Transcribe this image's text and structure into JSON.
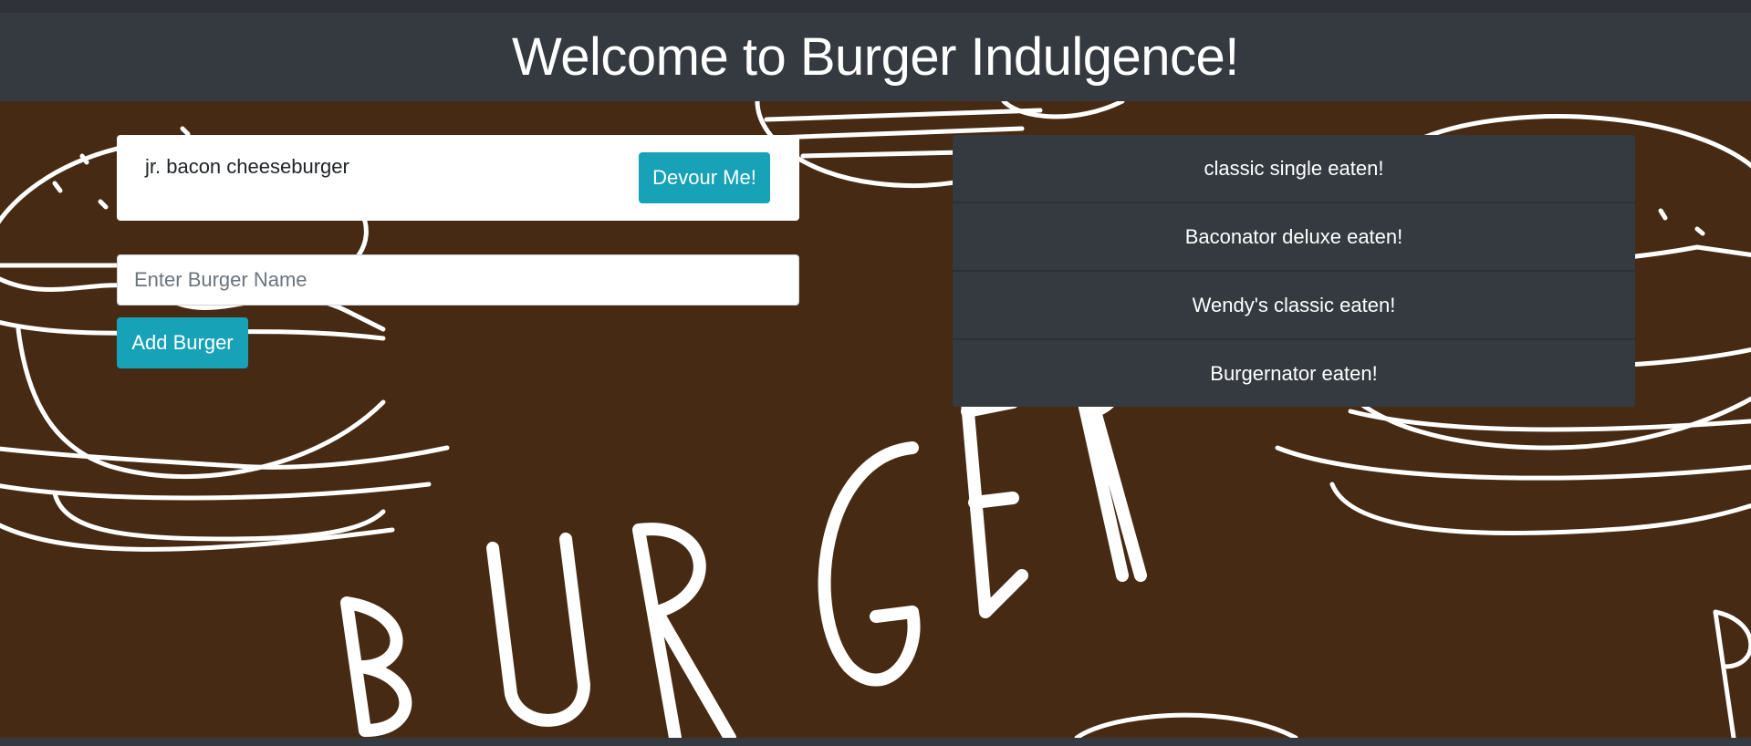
{
  "header": {
    "title": "Welcome to Burger Indulgence!"
  },
  "background": {
    "color": "#462a13",
    "stroke": "#ffffff",
    "wordmark": "BURGER"
  },
  "uneaten": [
    {
      "name": "jr. bacon cheeseburger",
      "button_label": "Devour Me!"
    }
  ],
  "form": {
    "placeholder": "Enter Burger Name",
    "value": "",
    "submit_label": "Add Burger"
  },
  "eaten": [
    {
      "label": "classic single eaten!"
    },
    {
      "label": "Baconator deluxe eaten!"
    },
    {
      "label": "Wendy's classic eaten!"
    },
    {
      "label": "Burgernator eaten!"
    }
  ],
  "colors": {
    "accent": "#17a2b8",
    "dark": "#343a40",
    "card": "#ffffff"
  }
}
